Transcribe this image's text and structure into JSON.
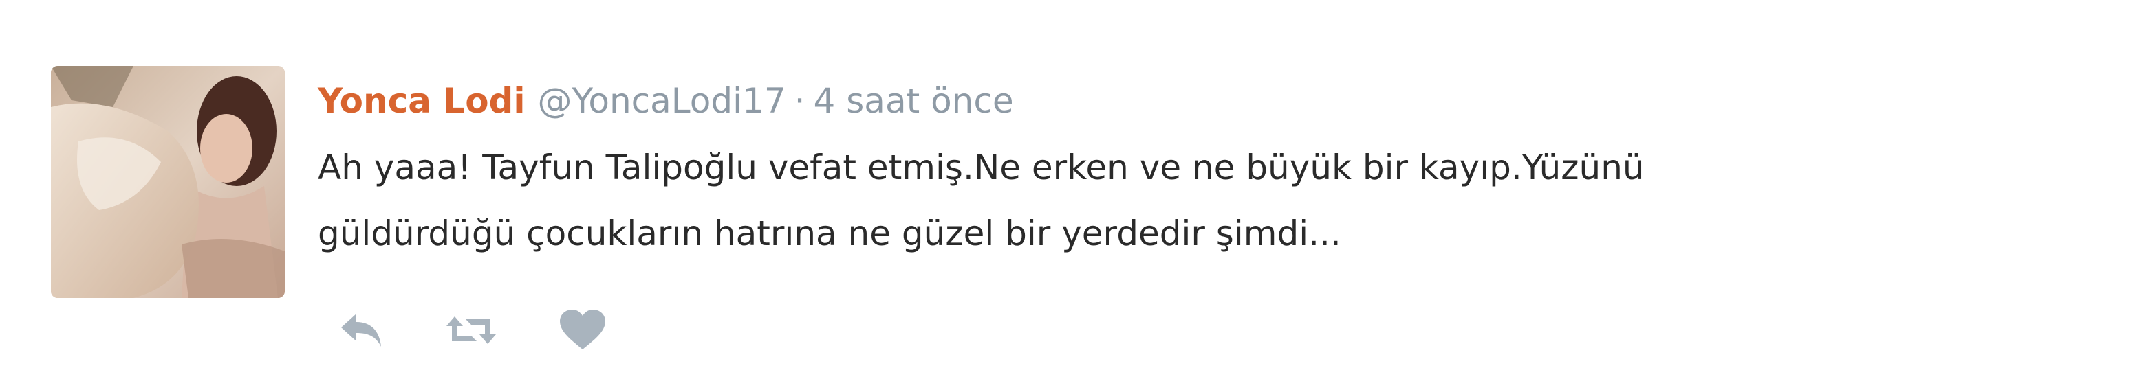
{
  "tweet": {
    "author_name": "Yonca Lodi",
    "handle": "@YoncaLodi17",
    "separator": "·",
    "time": "4 saat önce",
    "text_line_1": "Ah yaaa! Tayfun Talipoğlu vefat etmiş.Ne erken ve ne büyük bir kayıp.Yüzünü",
    "text_line_2": "güldürdüğü çocukların hatrına ne güzel bir yerdedir şimdi...",
    "avatar": "profile-photo",
    "actions": [
      "reply-icon",
      "retweet-icon",
      "like-icon"
    ]
  },
  "colors": {
    "name": "#d8642f",
    "meta": "#8e9aa5",
    "text": "#2a2a2a",
    "icon": "#a9b4be"
  }
}
